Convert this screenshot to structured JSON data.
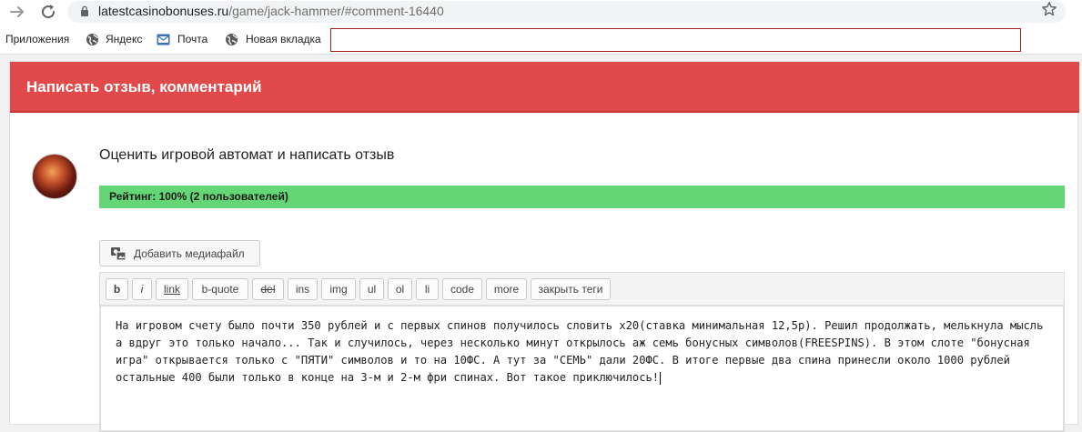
{
  "browser": {
    "url_host": "latestcasinobonuses.ru",
    "url_path": "/game/jack-hammer/#comment-16440",
    "icons": [
      "forward-icon",
      "reload-icon",
      "lock-icon",
      "star-icon"
    ]
  },
  "bookmarks": {
    "items": [
      {
        "label": "Приложения",
        "icon": "apps-icon"
      },
      {
        "label": "Яндекс",
        "icon": "globe-icon"
      },
      {
        "label": "Почта",
        "icon": "mail-icon"
      },
      {
        "label": "Новая вкладка",
        "icon": "globe-icon"
      }
    ],
    "input_value": ""
  },
  "page": {
    "header_title": "Написать отзыв, комментарий",
    "rate_title": "Оценить игровой автомат и написать отзыв",
    "rating_text": "Рейтинг: 100% (2 пользователей)",
    "media_button": "Добавить медиафайл"
  },
  "toolbar": {
    "buttons": [
      "b",
      "i",
      "link",
      "b-quote",
      "del",
      "ins",
      "img",
      "ul",
      "ol",
      "li",
      "code",
      "more",
      "закрыть теги"
    ]
  },
  "editor": {
    "text": "На игровом счету было почти 350 рублей и с первых спинов получилось словить x20(ставка минимальная 12,5р). Решил продолжать, мелькнула мысль а вдруг это только начало... Так и случилось, через несколько минут открылось аж семь бонусных символов(FREESPINS). В этом слоте \"бонусная игра\" открывается только с \"ПЯТИ\" символов и то на 10ФС. А тут за \"СЕМЬ\" дали 20ФС. В итоге первые два спина принесли около 1000 рублей остальные 400 были только в конце на 3-м и 2-м фри спинах. Вот такое приключилось!"
  },
  "colors": {
    "header": "#e04a4a",
    "rating_bar": "#64d675",
    "bookmark_input_border": "#a61b1b"
  }
}
